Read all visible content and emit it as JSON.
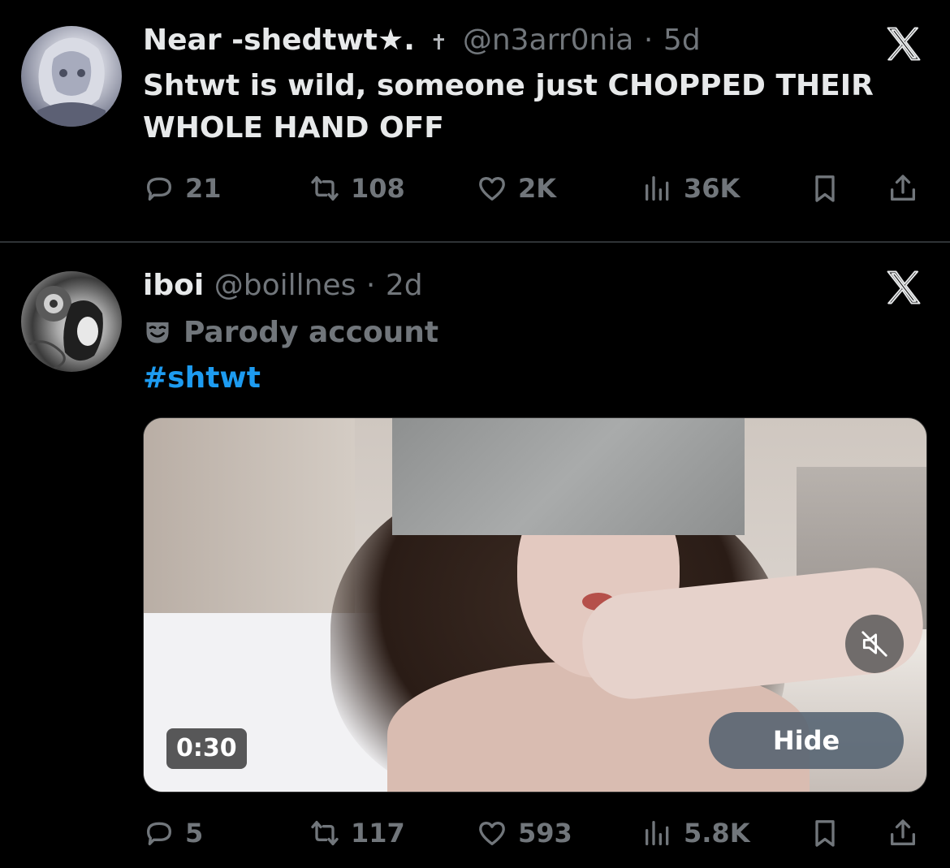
{
  "tweets": [
    {
      "display_name": "Near -shedtwt★.",
      "cross_glyph": "✝",
      "handle": "@n3arr0nia",
      "separator": "·",
      "time": "5d",
      "text": "Shtwt is wild, someone just CHOPPED THEIR WHOLE HAND OFF",
      "stats": {
        "replies": "21",
        "retweets": "108",
        "likes": "2K",
        "views": "36K"
      }
    },
    {
      "display_name": "iboi",
      "handle": "@boillnes",
      "separator": "·",
      "time": "2d",
      "parody_label": "Parody account",
      "hashtag": "#shtwt",
      "video": {
        "duration": "0:30",
        "hide_label": "Hide"
      },
      "stats": {
        "replies": "5",
        "retweets": "117",
        "likes": "593",
        "views": "5.8K"
      }
    }
  ],
  "colors": {
    "background": "#000000",
    "text": "#e7e9ea",
    "muted": "#71767b",
    "link": "#1d9bf0",
    "divider": "#2f3336"
  },
  "icons": [
    "reply-icon",
    "retweet-icon",
    "like-icon",
    "views-icon",
    "bookmark-icon",
    "share-icon",
    "x-logo-icon",
    "mute-icon",
    "parody-mask-icon"
  ]
}
